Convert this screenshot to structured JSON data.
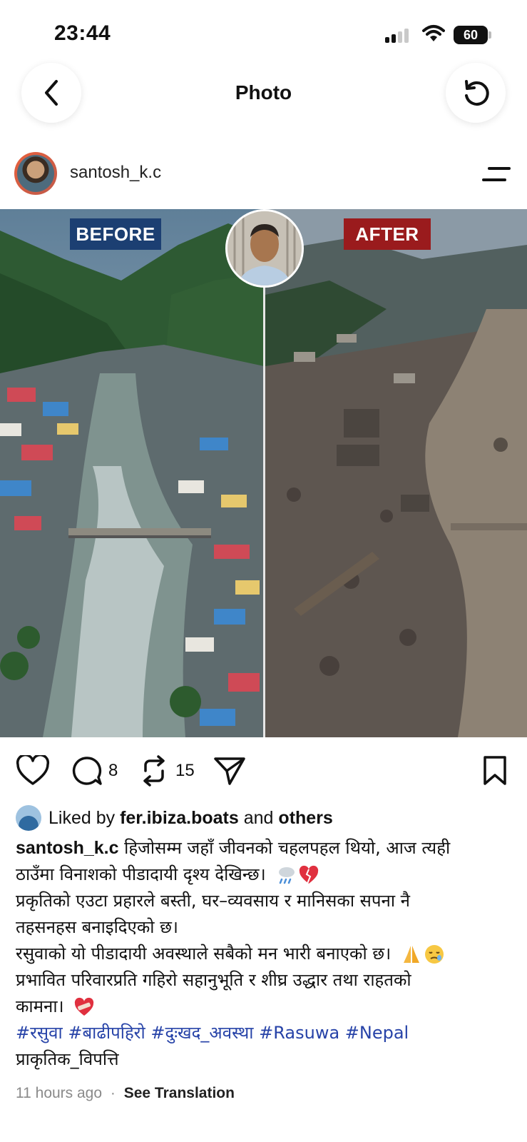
{
  "status_bar": {
    "time": "23:44",
    "battery": "60"
  },
  "nav": {
    "title": "Photo"
  },
  "post": {
    "username": "santosh_k.c",
    "labels": {
      "before": "BEFORE",
      "after": "AFTER"
    },
    "comment_count": "8",
    "repost_count": "15",
    "likes": {
      "prefix": "Liked by",
      "user": "fer.ibiza.boats",
      "joiner": "and",
      "others": "others"
    },
    "caption": {
      "username": "santosh_k.c",
      "lines": [
        "हिजोसम्म जहाँ जीवनको चहलपहल थियो, आज त्यही",
        "ठाउँमा विनाशको पीडादायी दृश्य देखिन्छ।",
        "प्रकृतिको एउटा प्रहारले बस्ती, घर–व्यवसाय र मानिसका सपना नै",
        "तहसनहस बनाइदिएको छ।",
        "रसुवाको यो पीडादायी अवस्थाले सबैको मन भारी बनाएको छ।",
        "प्रभावित परिवारप्रति गहिरो सहानुभूति र शीघ्र उद्धार तथा राहतको",
        "कामना।"
      ],
      "hashtags": "#रसुवा #बाढीपहिरो #दुःखद_अवस्था #Rasuwa #Nepal",
      "last_line": "प्राकृतिक_विपत्ति"
    },
    "time_ago": "11 hours ago",
    "separator": "·",
    "see_translation": "See Translation"
  },
  "icons": [
    "back-icon",
    "refresh-icon",
    "menu-icon",
    "heart-icon",
    "comment-icon",
    "repost-icon",
    "share-icon",
    "bookmark-icon",
    "cloud-rain-icon",
    "broken-heart-icon",
    "folded-hands-icon",
    "sad-face-icon",
    "heart-bandage-icon"
  ],
  "colors": {
    "before_label_bg": "#1c3f72",
    "after_label_bg": "#9a1b1d",
    "hashtag": "#2743a8"
  }
}
